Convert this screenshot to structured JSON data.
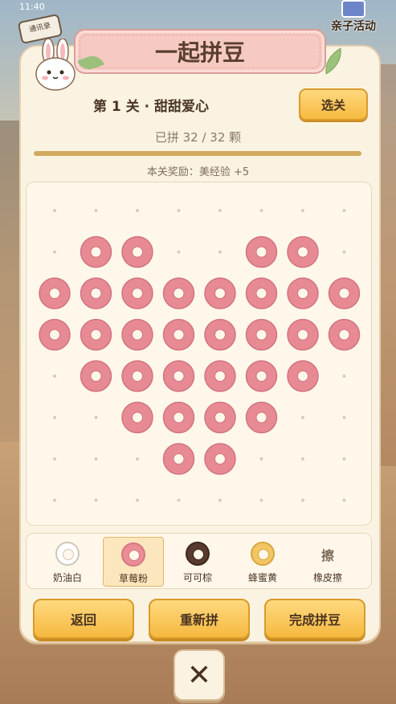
{
  "status": {
    "time": "11:40"
  },
  "badge": {
    "label": "通讯录"
  },
  "activity": {
    "label": "亲子活动"
  },
  "title": "一起拼豆",
  "level": {
    "label": "第 1 关 · 甜甜爱心"
  },
  "select_button": "选关",
  "progress": {
    "text": "已拼 32 / 32 颗",
    "placed": 32,
    "total": 32
  },
  "reward": "本关奖励：美经验 +5",
  "board": {
    "cols": 8,
    "rows": 8,
    "colors": {
      "pink": "#e88a94",
      "empty": "#d9cbb5"
    },
    "beads": [
      [
        0,
        0,
        0,
        0,
        0,
        0,
        0,
        0
      ],
      [
        0,
        1,
        1,
        0,
        0,
        1,
        1,
        0
      ],
      [
        1,
        1,
        1,
        1,
        1,
        1,
        1,
        1
      ],
      [
        1,
        1,
        1,
        1,
        1,
        1,
        1,
        1
      ],
      [
        0,
        1,
        1,
        1,
        1,
        1,
        1,
        0
      ],
      [
        0,
        0,
        1,
        1,
        1,
        1,
        0,
        0
      ],
      [
        0,
        0,
        0,
        1,
        1,
        0,
        0,
        0
      ],
      [
        0,
        0,
        0,
        0,
        0,
        0,
        0,
        0
      ]
    ]
  },
  "palette": [
    {
      "label": "奶油白",
      "color": "#ffffff",
      "ring": "#cfc6b8",
      "selected": false
    },
    {
      "label": "草莓粉",
      "color": "#ea8d97",
      "ring": "#d77883",
      "selected": true
    },
    {
      "label": "可可棕",
      "color": "#5a3a2e",
      "ring": "#3f271e",
      "selected": false
    },
    {
      "label": "蜂蜜黄",
      "color": "#f2c565",
      "ring": "#d9a640",
      "selected": false
    },
    {
      "label": "橡皮擦",
      "erase_glyph": "擦",
      "selected": false
    }
  ],
  "buttons": {
    "back": "返回",
    "restart": "重新拼",
    "finish": "完成拼豆"
  },
  "close_glyph": "✕"
}
